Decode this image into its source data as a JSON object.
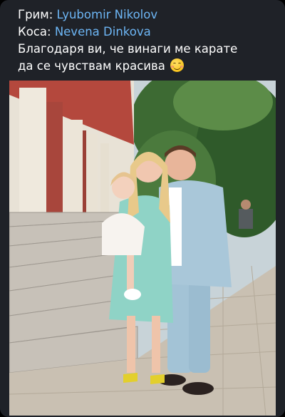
{
  "caption": {
    "makeup_label": "Грим:",
    "makeup_name": "Lyubomir Nikolov",
    "hair_label": "Коса:",
    "hair_name": "Nevena Dinkova",
    "line3": "Благодаря ви, че винаги ме карате",
    "line4": "да се чувствам красива",
    "emoji": "smiling-face-with-smiling-eyes-icon"
  },
  "colors": {
    "background": "#1f2228",
    "text": "#ffffff",
    "link": "#6db6f5"
  },
  "photo": {
    "subject": "family-photo"
  }
}
